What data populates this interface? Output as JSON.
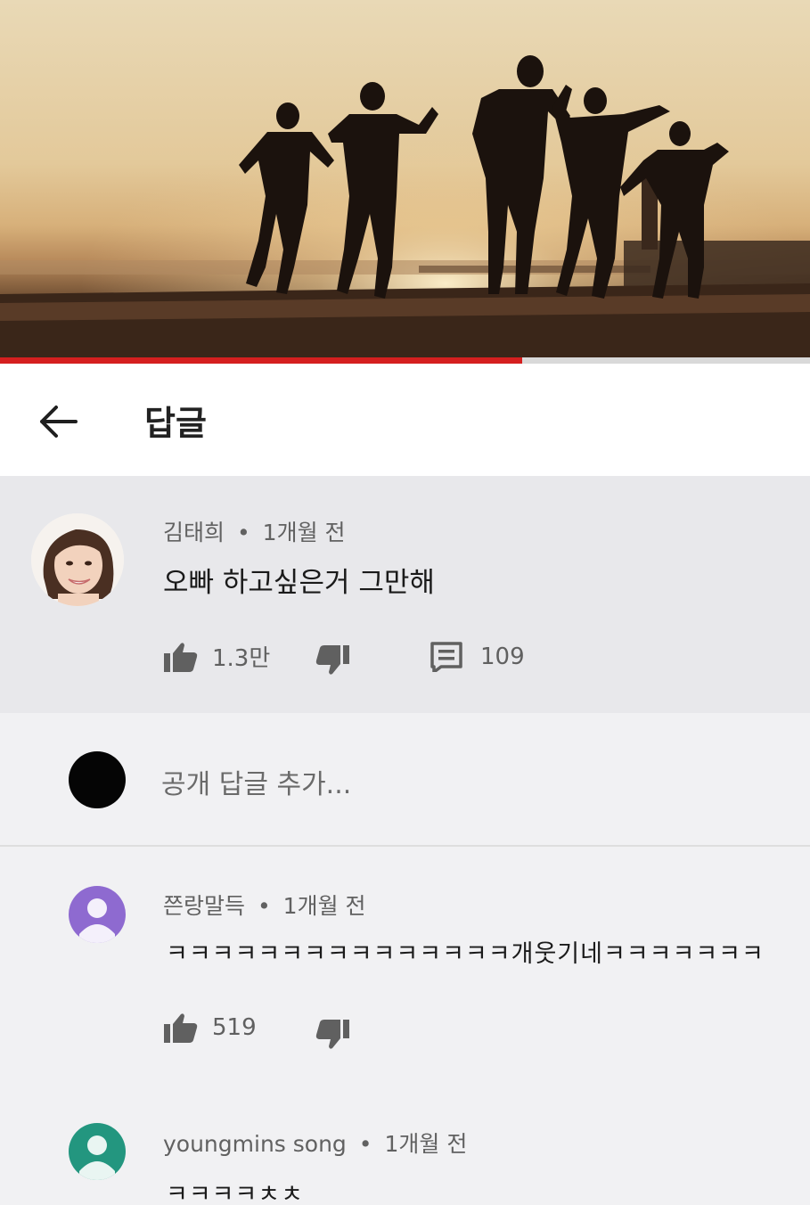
{
  "header": {
    "title": "답글"
  },
  "video": {
    "progress": 0.645
  },
  "top_comment": {
    "author": "김태희",
    "time": "1개월 전",
    "text": "오빠 하고싶은거 그만해",
    "likes": "1.3만",
    "replies": "109"
  },
  "reply_box": {
    "placeholder": "공개 답글 추가..."
  },
  "replies": [
    {
      "author": "쯘랑말득",
      "time": "1개월 전",
      "text": "ㅋㅋㅋㅋㅋㅋㅋㅋㅋㅋㅋㅋㅋㅋㅋ개웃기네ㅋㅋㅋㅋㅋㅋㅋ",
      "likes": "519",
      "avatar_color": "#8e6ad0"
    },
    {
      "author": "youngmins song",
      "time": "1개월 전",
      "text": "ㅋㅋㅋㅋㅊㅊ",
      "avatar_color": "#23967f"
    }
  ],
  "separator": "•",
  "icons": [
    "back-arrow-icon",
    "thumbs-up-icon",
    "thumbs-down-icon",
    "reply-icon",
    "default-avatar-icon"
  ]
}
